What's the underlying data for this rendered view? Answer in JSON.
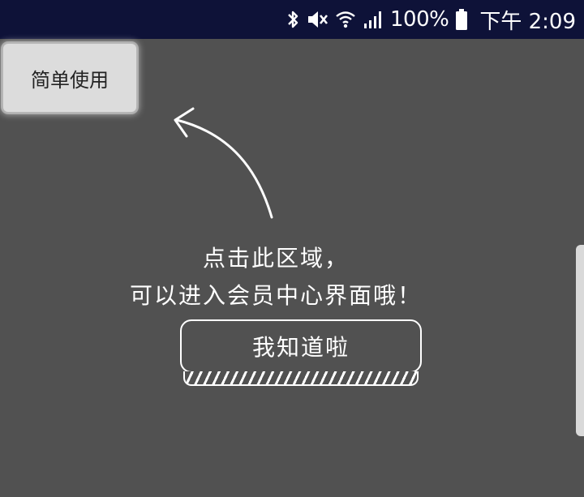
{
  "status_bar": {
    "battery_text": "100%",
    "time_text": "下午 2:09",
    "icons": [
      "bluetooth-icon",
      "mute-vibrate-icon",
      "wifi-icon",
      "signal-icon",
      "battery-icon"
    ]
  },
  "top_button": {
    "label": "简单使用"
  },
  "hint": {
    "line1": "点击此区域，",
    "line2": "可以进入会员中心界面哦！"
  },
  "confirm_button": {
    "label": "我知道啦"
  },
  "colors": {
    "background": "#515151",
    "status_bar": "#0e1238",
    "button_bg": "#dcdcdc",
    "overlay_text": "#ffffff"
  }
}
